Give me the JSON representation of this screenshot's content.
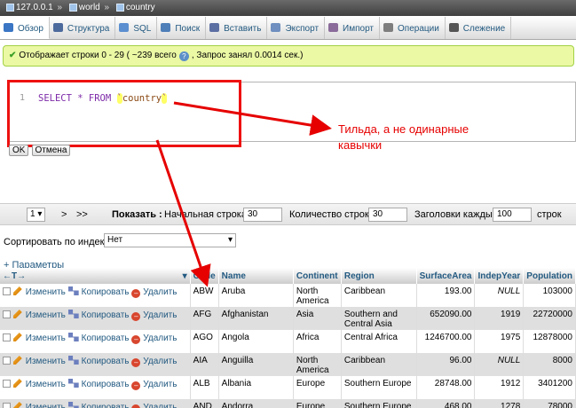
{
  "breadcrumb": {
    "server": "127.0.0.1",
    "database": "world",
    "table": "country"
  },
  "tabs": [
    {
      "label": "Обзор",
      "icon": "table-browse-icon",
      "color": "#3a76c4"
    },
    {
      "label": "Структура",
      "icon": "structure-icon",
      "color": "#4c6a9c"
    },
    {
      "label": "SQL",
      "icon": "sql-icon",
      "color": "#5b8fd0"
    },
    {
      "label": "Поиск",
      "icon": "search-icon",
      "color": "#4f7fb8"
    },
    {
      "label": "Вставить",
      "icon": "insert-icon",
      "color": "#5c6fa3"
    },
    {
      "label": "Экспорт",
      "icon": "export-icon",
      "color": "#6e8fbf"
    },
    {
      "label": "Импорт",
      "icon": "import-icon",
      "color": "#8a6b9a"
    },
    {
      "label": "Операции",
      "icon": "wrench-icon",
      "color": "#7e7e7e"
    },
    {
      "label": "Слежение",
      "icon": "eye-icon",
      "color": "#555555"
    }
  ],
  "message": {
    "text": "Отображает строки 0 - 29 ( ~239 всего",
    "query_time": ", Запрос занял 0.0014 сек.)"
  },
  "editor": {
    "line_number": "1",
    "keyword_part": "SELECT * FROM ",
    "tick_open": "`",
    "table_name": "country",
    "tick_close": "`"
  },
  "buttons": {
    "ok": "OK",
    "cancel": "Отмена"
  },
  "annotation": {
    "line1": "Тильда, а не одинарные",
    "line2": "кавычки",
    "color": "#e60000"
  },
  "navigation": {
    "page": "1",
    "next": ">",
    "last": ">>",
    "show_label": "Показать :",
    "start_label": "Начальная строка:",
    "start_value": "30",
    "rows_label": "Количество строк:",
    "rows_value": "30",
    "headers_label": "Заголовки каждые",
    "headers_value": "100",
    "rows_suffix": "строк"
  },
  "sort": {
    "label": "Сортировать по индексу:",
    "value": "Нет"
  },
  "options_link": "+ Параметры",
  "table": {
    "columns": [
      "Code",
      "Name",
      "Continent",
      "Region",
      "SurfaceArea",
      "IndepYear",
      "Population"
    ],
    "actions": {
      "edit": "Изменить",
      "copy": "Копировать",
      "delete": "Удалить"
    },
    "rows": [
      {
        "code": "ABW",
        "name": "Aruba",
        "continent": "North America",
        "region": "Caribbean",
        "surface": "193.00",
        "indep": "NULL",
        "population": "103000"
      },
      {
        "code": "AFG",
        "name": "Afghanistan",
        "continent": "Asia",
        "region": "Southern and Central Asia",
        "surface": "652090.00",
        "indep": "1919",
        "population": "22720000"
      },
      {
        "code": "AGO",
        "name": "Angola",
        "continent": "Africa",
        "region": "Central Africa",
        "surface": "1246700.00",
        "indep": "1975",
        "population": "12878000"
      },
      {
        "code": "AIA",
        "name": "Anguilla",
        "continent": "North America",
        "region": "Caribbean",
        "surface": "96.00",
        "indep": "NULL",
        "population": "8000"
      },
      {
        "code": "ALB",
        "name": "Albania",
        "continent": "Europe",
        "region": "Southern Europe",
        "surface": "28748.00",
        "indep": "1912",
        "population": "3401200"
      },
      {
        "code": "AND",
        "name": "Andorra",
        "continent": "Europe",
        "region": "Southern Europe",
        "surface": "468.00",
        "indep": "1278",
        "population": "78000"
      }
    ]
  }
}
